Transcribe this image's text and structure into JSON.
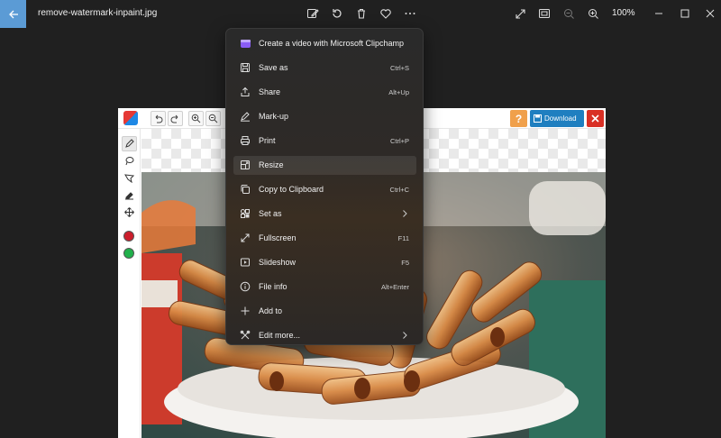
{
  "titlebar": {
    "filename": "remove-watermark-inpaint.jpg",
    "zoom": "100%",
    "icons": [
      "back-arrow-icon",
      "edit-image-icon",
      "rotate-icon",
      "delete-icon",
      "favorite-icon",
      "more-icon",
      "fullscreen-icon",
      "fit-icon",
      "zoom-out-icon",
      "zoom-in-icon",
      "minimize-icon",
      "maximize-icon",
      "close-icon"
    ]
  },
  "editor": {
    "download_label": "Download",
    "help_label": "?",
    "colors": {
      "red_dot": "#cc1e2c",
      "green_dot": "#21b04b",
      "download_bg": "#1f7fc0",
      "close_bg": "#d93025",
      "help_bg": "#f0a04b"
    }
  },
  "menu": {
    "items": [
      {
        "label": "Create a video with Microsoft Clipchamp",
        "shortcut": "",
        "icon": "clipchamp-icon"
      },
      {
        "label": "Save as",
        "shortcut": "Ctrl+S",
        "icon": "save-icon"
      },
      {
        "label": "Share",
        "shortcut": "Alt+Up",
        "icon": "share-icon"
      },
      {
        "label": "Mark-up",
        "shortcut": "",
        "icon": "markup-icon"
      },
      {
        "label": "Print",
        "shortcut": "Ctrl+P",
        "icon": "print-icon"
      },
      {
        "label": "Resize",
        "shortcut": "",
        "icon": "resize-icon"
      },
      {
        "label": "Copy to Clipboard",
        "shortcut": "Ctrl+C",
        "icon": "copy-icon"
      },
      {
        "label": "Set as",
        "shortcut": "",
        "icon": "set-as-icon",
        "submenu": true
      },
      {
        "label": "Fullscreen",
        "shortcut": "F11",
        "icon": "fullscreen-icon"
      },
      {
        "label": "Slideshow",
        "shortcut": "F5",
        "icon": "slideshow-icon"
      },
      {
        "label": "File info",
        "shortcut": "Alt+Enter",
        "icon": "info-icon"
      },
      {
        "label": "Add to",
        "shortcut": "",
        "icon": "add-icon"
      },
      {
        "label": "Edit more...",
        "shortcut": "",
        "icon": "edit-more-icon",
        "submenu": true
      }
    ],
    "hovered_item": "Resize"
  }
}
